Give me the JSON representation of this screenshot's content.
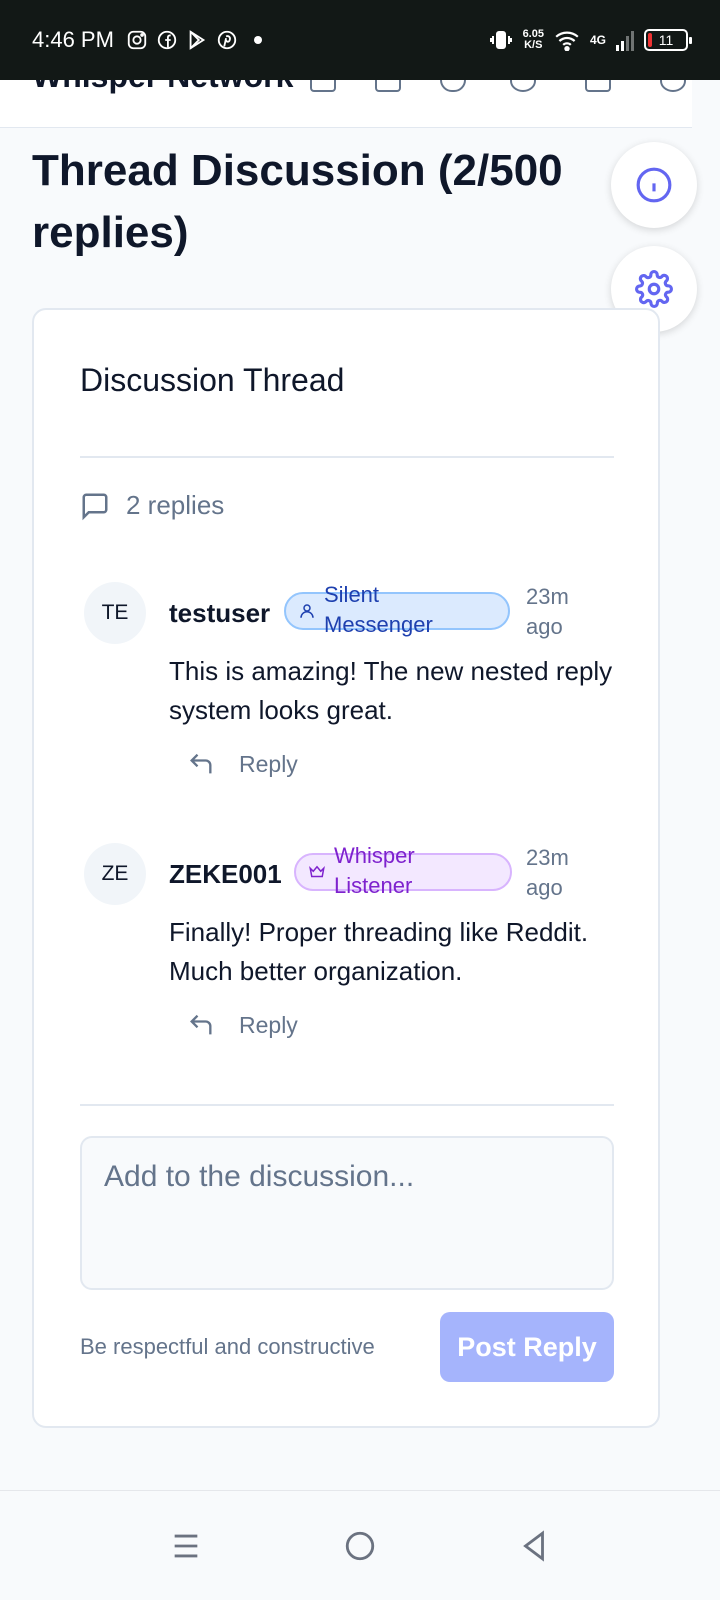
{
  "status_bar": {
    "time": "4:46 PM",
    "net_speed_value": "6.05",
    "net_speed_unit": "K/S",
    "network": "4G",
    "battery": "11"
  },
  "nav": {
    "brand": "Whisper Network"
  },
  "page": {
    "title": "Thread Discussion (2/500 replies)"
  },
  "thread": {
    "title": "Discussion Thread",
    "replies_label": "2 replies",
    "comments": [
      {
        "initials": "TE",
        "username": "testuser",
        "badge": "Silent Messenger",
        "time": "23m ago",
        "body": "This is amazing! The new nested reply system looks great.",
        "reply_label": "Reply"
      },
      {
        "initials": "ZE",
        "username": "ZEKE001",
        "badge": "Whisper Listener",
        "time": "23m ago",
        "body": "Finally! Proper threading like Reddit. Much better organization.",
        "reply_label": "Reply"
      }
    ],
    "input_placeholder": "Add to the discussion...",
    "hint": "Be respectful and constructive",
    "post_label": "Post Reply"
  },
  "colors": {
    "accent": "#6366f1",
    "post_button_disabled": "#a5b4fc",
    "badge_blue": "#dbeafe",
    "badge_purple": "#f3e8ff"
  },
  "icons": {
    "fab_top": "info-icon",
    "fab_bottom": "gear-icon",
    "replies": "message-square-icon",
    "reply": "reply-arrow-icon",
    "badge_1": "user-icon",
    "badge_2": "crown-icon"
  }
}
